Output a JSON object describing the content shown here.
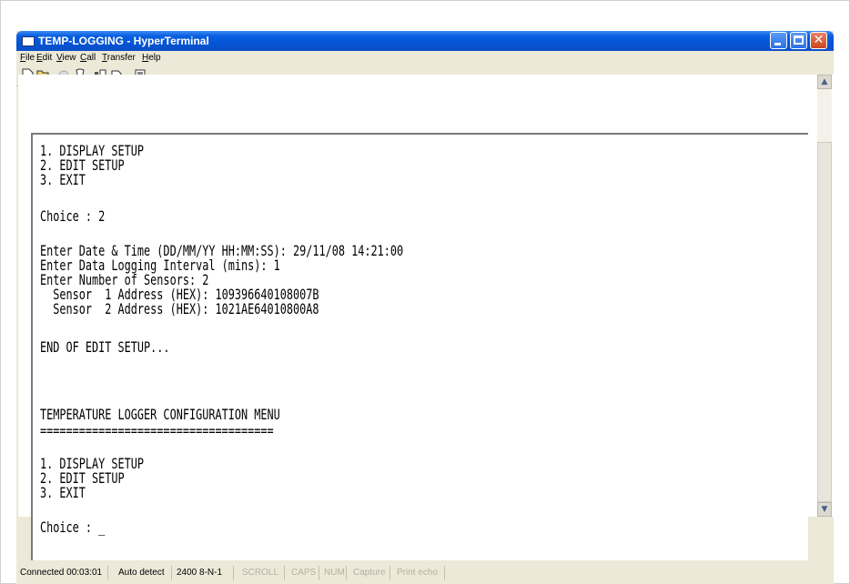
{
  "window": {
    "title": "TEMP-LOGGING - HyperTerminal"
  },
  "menu": [
    {
      "accel": "F",
      "rest": "ile"
    },
    {
      "accel": "E",
      "rest": "dit"
    },
    {
      "accel": "V",
      "rest": "iew"
    },
    {
      "accel": "C",
      "rest": "all"
    },
    {
      "accel": "T",
      "rest": "ransfer"
    },
    {
      "accel": "H",
      "rest": "elp"
    }
  ],
  "toolbar": {
    "icons": [
      "new-icon",
      "open-icon",
      "disconnect-icon",
      "dial-icon",
      "send-icon",
      "receive-icon",
      "properties-icon"
    ]
  },
  "terminal": {
    "lines": [
      "1. DISPLAY SETUP",
      "2. EDIT SETUP",
      "3. EXIT",
      "",
      "Choice : 2",
      "",
      "Enter Date & Time (DD/MM/YY HH:MM:SS): 29/11/08 14:21:00",
      "Enter Data Logging Interval (mins): 1",
      "Enter Number of Sensors: 2",
      "  Sensor  1 Address (HEX): 109396640108007B",
      "  Sensor  2 Address (HEX): 1021AE64010800A8",
      "",
      "END OF EDIT SETUP...",
      "",
      "",
      "",
      "TEMPERATURE LOGGER CONFIGURATION MENU",
      "====================================",
      "",
      "1. DISPLAY SETUP",
      "2. EDIT SETUP",
      "3. EXIT",
      "",
      "Choice : _"
    ]
  },
  "status": {
    "connected": "Connected 00:03:01",
    "detect": "Auto detect",
    "settings": "2400 8-N-1",
    "scroll": "SCROLL",
    "caps": "CAPS",
    "num": "NUM",
    "capture": "Capture",
    "print_echo": "Print echo"
  }
}
